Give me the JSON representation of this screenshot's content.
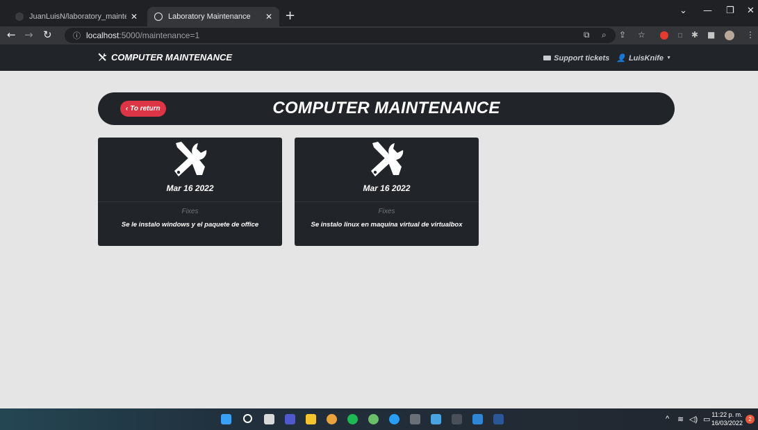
{
  "browser": {
    "tabs": [
      {
        "title": "JuanLuisN/laboratory_maintenan"
      },
      {
        "title": "Laboratory Maintenance"
      }
    ],
    "url_host": "localhost",
    "url_path": ":5000/maintenance=1"
  },
  "navbar": {
    "brand": "COMPUTER MAINTENANCE",
    "support_link": "Support tickets",
    "user_menu": "LuisKnife"
  },
  "header": {
    "return_label": "‹ To return",
    "title": "COMPUTER MAINTENANCE"
  },
  "cards": [
    {
      "date": "Mar 16 2022",
      "label": "Fixes",
      "description": "Se le instalo windows y el paquete de office"
    },
    {
      "date": "Mar 16 2022",
      "label": "Fixes",
      "description": "Se instalo linux en maquina virtual de virtualbox"
    }
  ],
  "taskbar": {
    "time": "11:22 p. m.",
    "date": "16/03/2022",
    "notification_count": "2"
  },
  "colors": {
    "navbar_bg": "#212529",
    "accent_red": "#dc3545",
    "page_bg": "#e5e5e5"
  }
}
